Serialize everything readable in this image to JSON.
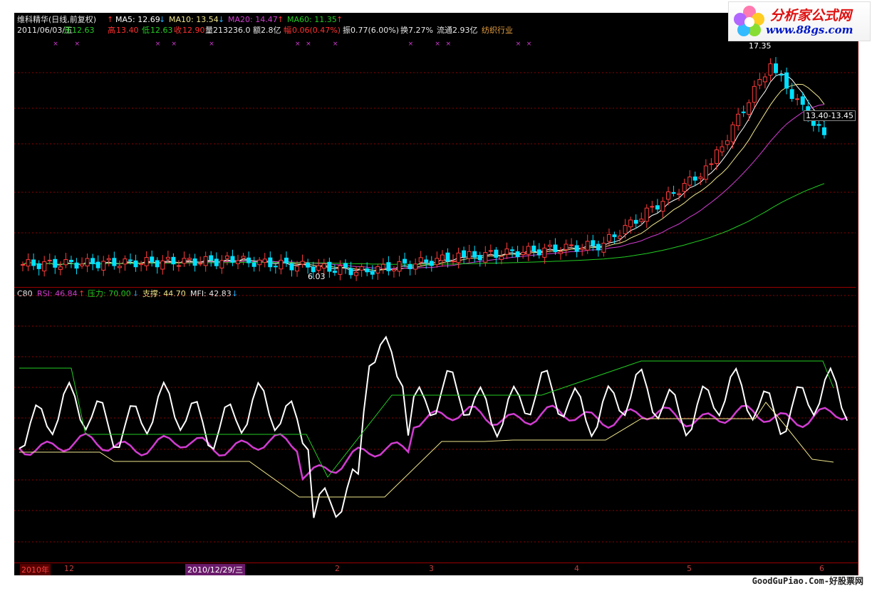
{
  "header": {
    "stock_name": "维科精华(日线,前复权)",
    "ma5": "MA5: 12.69",
    "ma10": "MA10: 13.54",
    "ma20": "MA20: 14.47",
    "ma60": "MA60: 11.35",
    "date": "2011/06/03/五",
    "open_label": "开",
    "open": "12.63",
    "high_label": "高",
    "high": "13.40",
    "low_label": "低",
    "low": "12.63",
    "close_label": "收",
    "close": "12.90",
    "volume": "量213236.0",
    "amount": "额2.8亿",
    "range_label": "幅",
    "range": "0.06(0.47%)",
    "amplitude": "振0.77(6.00%)",
    "turnover": "换7.27%",
    "float": "流通2.93亿",
    "industry": "纺织行业"
  },
  "annotations": {
    "high_price": "17.35",
    "low_price": "6.03",
    "cursor_price": "13.40-13.45"
  },
  "indicator": {
    "name": "C80",
    "rsi": "RSI: 46.84",
    "pressure": "压力: 70.00",
    "support": "支撑: 44.70",
    "mfi": "MFI: 42.83"
  },
  "time_axis": {
    "year_label": "2010年",
    "labels": [
      "12",
      "2010/12/29/三",
      "2",
      "3",
      "4",
      "5",
      "6"
    ]
  },
  "logo": {
    "title": "分析家公式网",
    "url": "www.88gs.com"
  },
  "footer": "GoodGuPiao.Com-好股票网",
  "colors": {
    "background": "#000000",
    "up_candle": "#ff3b3b",
    "down_candle": "#00e0ff",
    "ma5": "#ffffff",
    "ma10": "#f0e68c",
    "ma20": "#d23cd2",
    "ma60": "#22cc22",
    "grid": "#8b0000"
  },
  "chart_data": [
    {
      "type": "candlestick",
      "title": "维科精华(日线,前复权)",
      "x_range": [
        "2010-11-01",
        "2011-06-03"
      ],
      "highest": 17.35,
      "lowest": 6.03,
      "last": {
        "open": 12.63,
        "high": 13.4,
        "low": 12.63,
        "close": 12.9
      },
      "series": [
        {
          "name": "MA5",
          "last": 12.69
        },
        {
          "name": "MA10",
          "last": 13.54
        },
        {
          "name": "MA20",
          "last": 14.47
        },
        {
          "name": "MA60",
          "last": 11.35
        }
      ]
    },
    {
      "type": "line",
      "title": "C80",
      "series": [
        {
          "name": "RSI",
          "last": 46.84
        },
        {
          "name": "压力",
          "last": 70.0
        },
        {
          "name": "支撑",
          "last": 44.7
        },
        {
          "name": "MFI",
          "last": 42.83
        }
      ]
    }
  ]
}
